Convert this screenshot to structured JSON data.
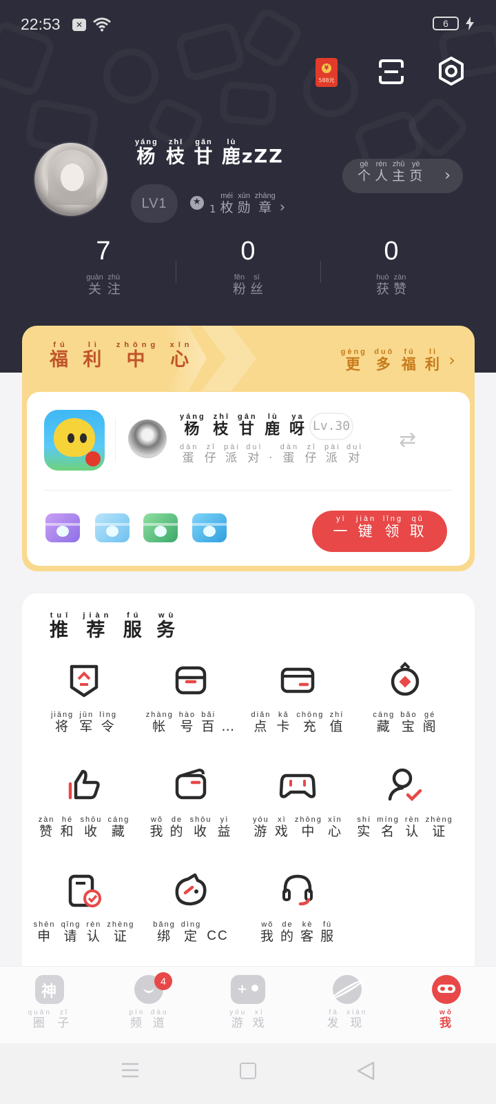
{
  "status_bar": {
    "time": "22:53",
    "battery": "6"
  },
  "header": {
    "red_packet": "588元",
    "profile": {
      "name_chars": [
        {
          "han": "杨",
          "pin": "yáng"
        },
        {
          "han": "枝",
          "pin": "zhī"
        },
        {
          "han": "甘",
          "pin": "gān"
        },
        {
          "han": "鹿",
          "pin": "lù"
        }
      ],
      "name_suffix": "zZZ",
      "level": "LV1",
      "medal_count": "1",
      "medal_chars": [
        {
          "han": "枚",
          "pin": "méi"
        },
        {
          "han": "勋",
          "pin": "xūn"
        },
        {
          "han": "章",
          "pin": "zhāng"
        }
      ],
      "personal_chars": [
        {
          "han": "个",
          "pin": "gè"
        },
        {
          "han": "人",
          "pin": "rén"
        },
        {
          "han": "主",
          "pin": "zhǔ"
        },
        {
          "han": "页",
          "pin": "yè"
        }
      ]
    },
    "stats": [
      {
        "value": "7",
        "label": [
          {
            "han": "关",
            "pin": "guān"
          },
          {
            "han": "注",
            "pin": "zhù"
          }
        ]
      },
      {
        "value": "0",
        "label": [
          {
            "han": "粉",
            "pin": "fěn"
          },
          {
            "han": "丝",
            "pin": "sī"
          }
        ]
      },
      {
        "value": "0",
        "label": [
          {
            "han": "获",
            "pin": "huò"
          },
          {
            "han": "赞",
            "pin": "zàn"
          }
        ]
      }
    ]
  },
  "welfare": {
    "title": [
      {
        "han": "福",
        "pin": "fú"
      },
      {
        "han": "利",
        "pin": "lì"
      },
      {
        "han": "中",
        "pin": "zhōng"
      },
      {
        "han": "心",
        "pin": "xīn"
      }
    ],
    "more": [
      {
        "han": "更",
        "pin": "gèng"
      },
      {
        "han": "多",
        "pin": "duō"
      },
      {
        "han": "福",
        "pin": "fú"
      },
      {
        "han": "利",
        "pin": "lì"
      }
    ],
    "role_name": [
      {
        "han": "杨",
        "pin": "yáng"
      },
      {
        "han": "枝",
        "pin": "zhī"
      },
      {
        "han": "甘",
        "pin": "gān"
      },
      {
        "han": "鹿",
        "pin": "lù"
      },
      {
        "han": "呀",
        "pin": "ya"
      }
    ],
    "role_level": "Lv.30",
    "server": [
      {
        "han": "蛋",
        "pin": "dàn"
      },
      {
        "han": "仔",
        "pin": "zǐ"
      },
      {
        "han": "派",
        "pin": "pài"
      },
      {
        "han": "对",
        "pin": "duì"
      },
      {
        "han": "·",
        "pin": ""
      },
      {
        "han": "蛋",
        "pin": "dàn"
      },
      {
        "han": "仔",
        "pin": "zǐ"
      },
      {
        "han": "派",
        "pin": "pài"
      },
      {
        "han": "对",
        "pin": "duì"
      }
    ],
    "claim": [
      {
        "han": "一",
        "pin": "yī"
      },
      {
        "han": "键",
        "pin": "jiàn"
      },
      {
        "han": "领",
        "pin": "lǐng"
      },
      {
        "han": "取",
        "pin": "qǔ"
      }
    ]
  },
  "services": {
    "title": [
      {
        "han": "推",
        "pin": "tuī"
      },
      {
        "han": "荐",
        "pin": "jiàn"
      },
      {
        "han": "服",
        "pin": "fú"
      },
      {
        "han": "务",
        "pin": "wù"
      }
    ],
    "items": [
      {
        "icon": "token-icon",
        "label": [
          {
            "han": "将",
            "pin": "jiāng"
          },
          {
            "han": "军",
            "pin": "jūn"
          },
          {
            "han": "令",
            "pin": "lìng"
          }
        ]
      },
      {
        "icon": "account-box-icon",
        "label": [
          {
            "han": "帐",
            "pin": "zhàng"
          },
          {
            "han": "号",
            "pin": "hào"
          },
          {
            "han": "百",
            "pin": "bǎi"
          },
          {
            "han": "…",
            "pin": ""
          }
        ]
      },
      {
        "icon": "card-icon",
        "label": [
          {
            "han": "点",
            "pin": "diǎn"
          },
          {
            "han": "卡",
            "pin": "kǎ"
          },
          {
            "han": "充",
            "pin": "chōng"
          },
          {
            "han": "值",
            "pin": "zhí"
          }
        ]
      },
      {
        "icon": "treasure-icon",
        "label": [
          {
            "han": "藏",
            "pin": "cáng"
          },
          {
            "han": "宝",
            "pin": "bǎo"
          },
          {
            "han": "阁",
            "pin": "gé"
          }
        ]
      },
      {
        "icon": "thumbs-up-icon",
        "label": [
          {
            "han": "赞",
            "pin": "zàn"
          },
          {
            "han": "和",
            "pin": "hé"
          },
          {
            "han": "收",
            "pin": "shōu"
          },
          {
            "han": "藏",
            "pin": "cáng"
          }
        ]
      },
      {
        "icon": "wallet-icon",
        "label": [
          {
            "han": "我",
            "pin": "wǒ"
          },
          {
            "han": "的",
            "pin": "de"
          },
          {
            "han": "收",
            "pin": "shōu"
          },
          {
            "han": "益",
            "pin": "yì"
          }
        ]
      },
      {
        "icon": "gamepad-icon",
        "label": [
          {
            "han": "游",
            "pin": "yóu"
          },
          {
            "han": "戏",
            "pin": "xì"
          },
          {
            "han": "中",
            "pin": "zhōng"
          },
          {
            "han": "心",
            "pin": "xīn"
          }
        ]
      },
      {
        "icon": "verified-user-icon",
        "label": [
          {
            "han": "实",
            "pin": "shí"
          },
          {
            "han": "名",
            "pin": "míng"
          },
          {
            "han": "认",
            "pin": "rèn"
          },
          {
            "han": "证",
            "pin": "zhèng"
          }
        ]
      },
      {
        "icon": "apply-cert-icon",
        "label": [
          {
            "han": "申",
            "pin": "shēn"
          },
          {
            "han": "请",
            "pin": "qǐng"
          },
          {
            "han": "认",
            "pin": "rèn"
          },
          {
            "han": "证",
            "pin": "zhèng"
          }
        ]
      },
      {
        "icon": "bind-cc-icon",
        "label": [
          {
            "han": "绑",
            "pin": "bǎng"
          },
          {
            "han": "定",
            "pin": "dìng"
          },
          {
            "han": "CC",
            "pin": ""
          }
        ]
      },
      {
        "icon": "headset-icon",
        "label": [
          {
            "han": "我",
            "pin": "wǒ"
          },
          {
            "han": "的",
            "pin": "de"
          },
          {
            "han": "客",
            "pin": "kè"
          },
          {
            "han": "服",
            "pin": "fú"
          }
        ]
      }
    ]
  },
  "tabs": [
    {
      "icon": "circle-god-icon",
      "label": [
        {
          "han": "圈",
          "pin": "quān"
        },
        {
          "han": "子",
          "pin": "zǐ"
        }
      ],
      "active": false
    },
    {
      "icon": "channel-icon",
      "label": [
        {
          "han": "频",
          "pin": "pín"
        },
        {
          "han": "道",
          "pin": "dào"
        }
      ],
      "active": false,
      "badge": "4"
    },
    {
      "icon": "game-icon",
      "label": [
        {
          "han": "游",
          "pin": "yóu"
        },
        {
          "han": "戏",
          "pin": "xì"
        }
      ],
      "active": false
    },
    {
      "icon": "planet-icon",
      "label": [
        {
          "han": "发",
          "pin": "fā"
        },
        {
          "han": "现",
          "pin": "xiàn"
        }
      ],
      "active": false
    },
    {
      "icon": "me-icon",
      "label": [
        {
          "han": "我",
          "pin": "wǒ"
        }
      ],
      "active": true
    }
  ],
  "colors": {
    "accent": "#e84848",
    "header_bg": "#2c2c3a",
    "welfare_bg": "#f9d98d"
  }
}
